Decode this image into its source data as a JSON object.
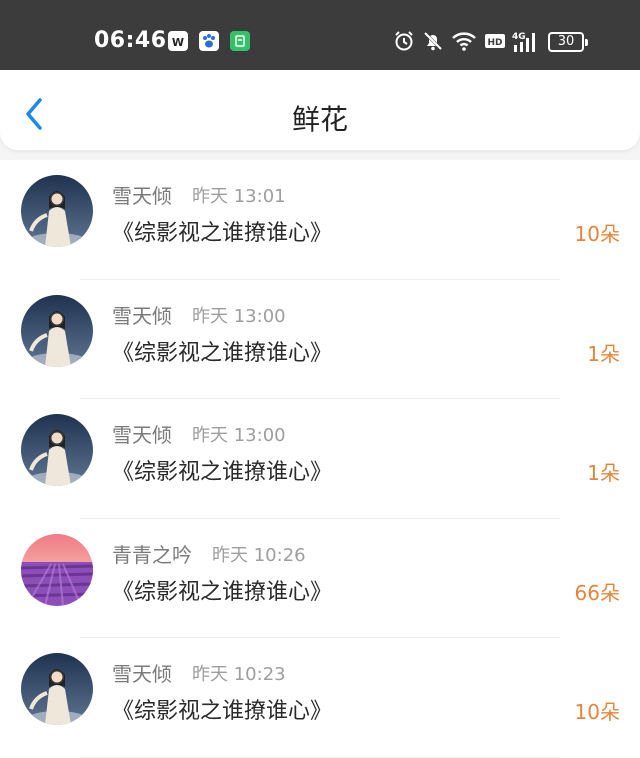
{
  "status_bar": {
    "time": "06:46",
    "app_icons": [
      "wps-icon",
      "baidu-paw-icon",
      "green-app-icon"
    ],
    "battery": "30"
  },
  "header": {
    "title": "鲜花"
  },
  "colors": {
    "accent_blue": "#1e88e5",
    "count_orange": "#e8843a"
  },
  "list": [
    {
      "user": "雪天倾",
      "time": "昨天 13:01",
      "book": "《综影视之谁撩谁心》",
      "count": "10朵",
      "avatar": "portrait"
    },
    {
      "user": "雪天倾",
      "time": "昨天 13:00",
      "book": "《综影视之谁撩谁心》",
      "count": "1朵",
      "avatar": "portrait"
    },
    {
      "user": "雪天倾",
      "time": "昨天 13:00",
      "book": "《综影视之谁撩谁心》",
      "count": "1朵",
      "avatar": "portrait"
    },
    {
      "user": "青青之吟",
      "time": "昨天 10:26",
      "book": "《综影视之谁撩谁心》",
      "count": "66朵",
      "avatar": "lavender"
    },
    {
      "user": "雪天倾",
      "time": "昨天 10:23",
      "book": "《综影视之谁撩谁心》",
      "count": "10朵",
      "avatar": "portrait"
    }
  ]
}
